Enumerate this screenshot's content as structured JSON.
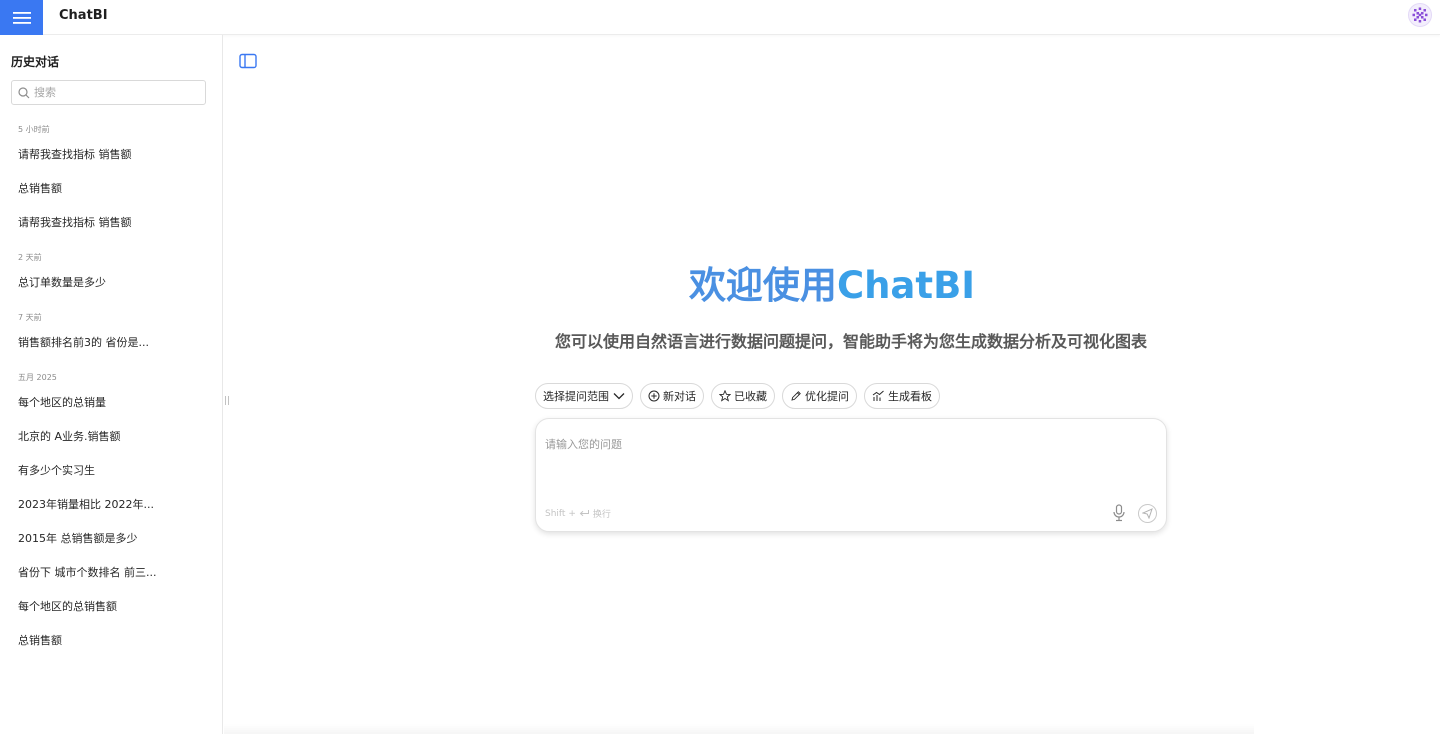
{
  "app": {
    "title": "ChatBI"
  },
  "sidebar": {
    "heading": "历史对话",
    "search_placeholder": "搜索",
    "groups": [
      {
        "label": "5 小时前",
        "items": [
          "请帮我查找指标 销售额",
          "总销售额",
          "请帮我查找指标 销售额"
        ]
      },
      {
        "label": "2 天前",
        "items": [
          "总订单数量是多少"
        ]
      },
      {
        "label": "7 天前",
        "items": [
          "销售额排名前3的 省份是..."
        ]
      },
      {
        "label": "五月 2025",
        "items": [
          "每个地区的总销量",
          "北京的 A业务.销售额",
          "有多少个实习生",
          "2023年销量相比 2022年...",
          "2015年 总销售额是多少",
          "省份下 城市个数排名 前三...",
          "每个地区的总销售额",
          "总销售额"
        ]
      }
    ]
  },
  "main": {
    "welcome_prefix": "欢迎使用",
    "welcome_brand": "ChatBI",
    "subtitle": "您可以使用自然语言进行数据问题提问，智能助手将为您生成数据分析及可视化图表",
    "toolbar": {
      "scope": "选择提问范围",
      "new_chat": "新对话",
      "favorites": "已收藏",
      "optimize": "优化提问",
      "dashboard": "生成看板"
    },
    "input": {
      "placeholder": "请输入您的问题",
      "hint_key": "Shift +",
      "hint_action": "换行"
    }
  },
  "colors": {
    "accent": "#3a78f2",
    "brand_text": "#3a8ee6"
  }
}
